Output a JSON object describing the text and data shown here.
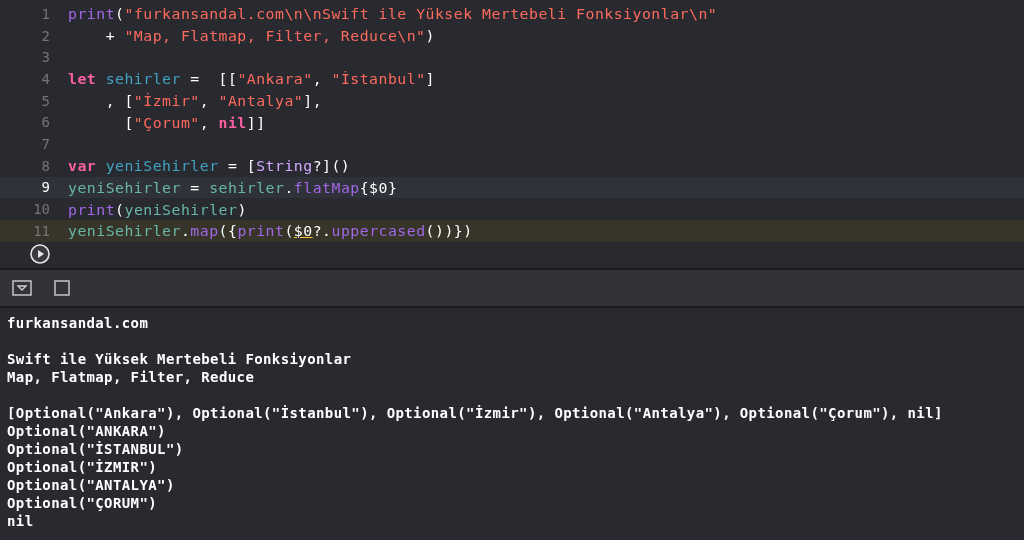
{
  "editor": {
    "lines": [
      {
        "number": "1",
        "kind": "plain",
        "tokens": [
          {
            "kind": "func",
            "text": "print"
          },
          {
            "kind": "plain",
            "text": "("
          },
          {
            "kind": "string",
            "text": "\"furkansandal.com\\n\\nSwift ile Yüksek Mertebeli Fonksiyonlar\\n\""
          }
        ]
      },
      {
        "number": "2",
        "kind": "plain",
        "tokens": [
          {
            "kind": "plain",
            "text": "    + "
          },
          {
            "kind": "string",
            "text": "\"Map, Flatmap, Filter, Reduce\\n\""
          },
          {
            "kind": "plain",
            "text": ")"
          }
        ]
      },
      {
        "number": "3",
        "kind": "plain"
      },
      {
        "number": "4",
        "kind": "plain",
        "tokens": [
          {
            "kind": "keyword",
            "text": "let "
          },
          {
            "kind": "decl",
            "text": "sehirler"
          },
          {
            "kind": "plain",
            "text": " =  [["
          },
          {
            "kind": "string",
            "text": "\"Ankara\""
          },
          {
            "kind": "plain",
            "text": ", "
          },
          {
            "kind": "string",
            "text": "\"İstanbul\""
          },
          {
            "kind": "plain",
            "text": "]"
          }
        ]
      },
      {
        "number": "5",
        "kind": "plain",
        "tokens": [
          {
            "kind": "plain",
            "text": "    , ["
          },
          {
            "kind": "string",
            "text": "\"İzmir\""
          },
          {
            "kind": "plain",
            "text": ", "
          },
          {
            "kind": "string",
            "text": "\"Antalya\""
          },
          {
            "kind": "plain",
            "text": "],"
          }
        ]
      },
      {
        "number": "6",
        "kind": "plain",
        "tokens": [
          {
            "kind": "plain",
            "text": "      ["
          },
          {
            "kind": "string",
            "text": "\"Çorum\""
          },
          {
            "kind": "plain",
            "text": ", "
          },
          {
            "kind": "keyword",
            "text": "nil"
          },
          {
            "kind": "plain",
            "text": "]]"
          }
        ]
      },
      {
        "number": "7",
        "kind": "plain"
      },
      {
        "number": "8",
        "kind": "plain",
        "tokens": [
          {
            "kind": "keyword",
            "text": "var "
          },
          {
            "kind": "decl",
            "text": "yeniSehirler"
          },
          {
            "kind": "plain",
            "text": " = ["
          },
          {
            "kind": "type",
            "text": "String"
          },
          {
            "kind": "plain",
            "text": "?]()"
          }
        ]
      },
      {
        "number": "9",
        "kind": "current",
        "tokens": [
          {
            "kind": "ident",
            "text": "yeniSehirler"
          },
          {
            "kind": "plain",
            "text": " = "
          },
          {
            "kind": "ident",
            "text": "sehirler"
          },
          {
            "kind": "plain",
            "text": "."
          },
          {
            "kind": "func",
            "text": "flatMap"
          },
          {
            "kind": "plain",
            "text": "{$0}"
          }
        ]
      },
      {
        "number": "10",
        "kind": "plain",
        "tokens": [
          {
            "kind": "func",
            "text": "print"
          },
          {
            "kind": "plain",
            "text": "("
          },
          {
            "kind": "ident",
            "text": "yeniSehirler"
          },
          {
            "kind": "plain",
            "text": ")"
          }
        ]
      },
      {
        "number": "11",
        "kind": "run",
        "tokens": [
          {
            "kind": "ident",
            "text": "yeniSehirler"
          },
          {
            "kind": "plain",
            "text": "."
          },
          {
            "kind": "func",
            "text": "map"
          },
          {
            "kind": "plain",
            "text": "({"
          },
          {
            "kind": "func",
            "text": "print"
          },
          {
            "kind": "plain",
            "text": "("
          },
          {
            "kind": "warning",
            "text": "$0"
          },
          {
            "kind": "plain",
            "text": "?."
          },
          {
            "kind": "func",
            "text": "uppercased"
          },
          {
            "kind": "plain",
            "text": "())})"
          }
        ]
      }
    ]
  },
  "console": {
    "output": [
      [
        "furkansandal.com"
      ],
      [
        "Swift ile Yüksek Mertebeli Fonksiyonlar",
        "Map, Flatmap, Filter, Reduce"
      ],
      [
        "[Optional(\"Ankara\"), Optional(\"İstanbul\"), Optional(\"İzmir\"), Optional(\"Antalya\"), Optional(\"Çorum\"), nil]",
        "Optional(\"ANKARA\")",
        "Optional(\"İSTANBUL\")",
        "Optional(\"İZMIR\")",
        "Optional(\"ANTALYA\")",
        "Optional(\"ÇORUM\")",
        "nil"
      ]
    ]
  }
}
